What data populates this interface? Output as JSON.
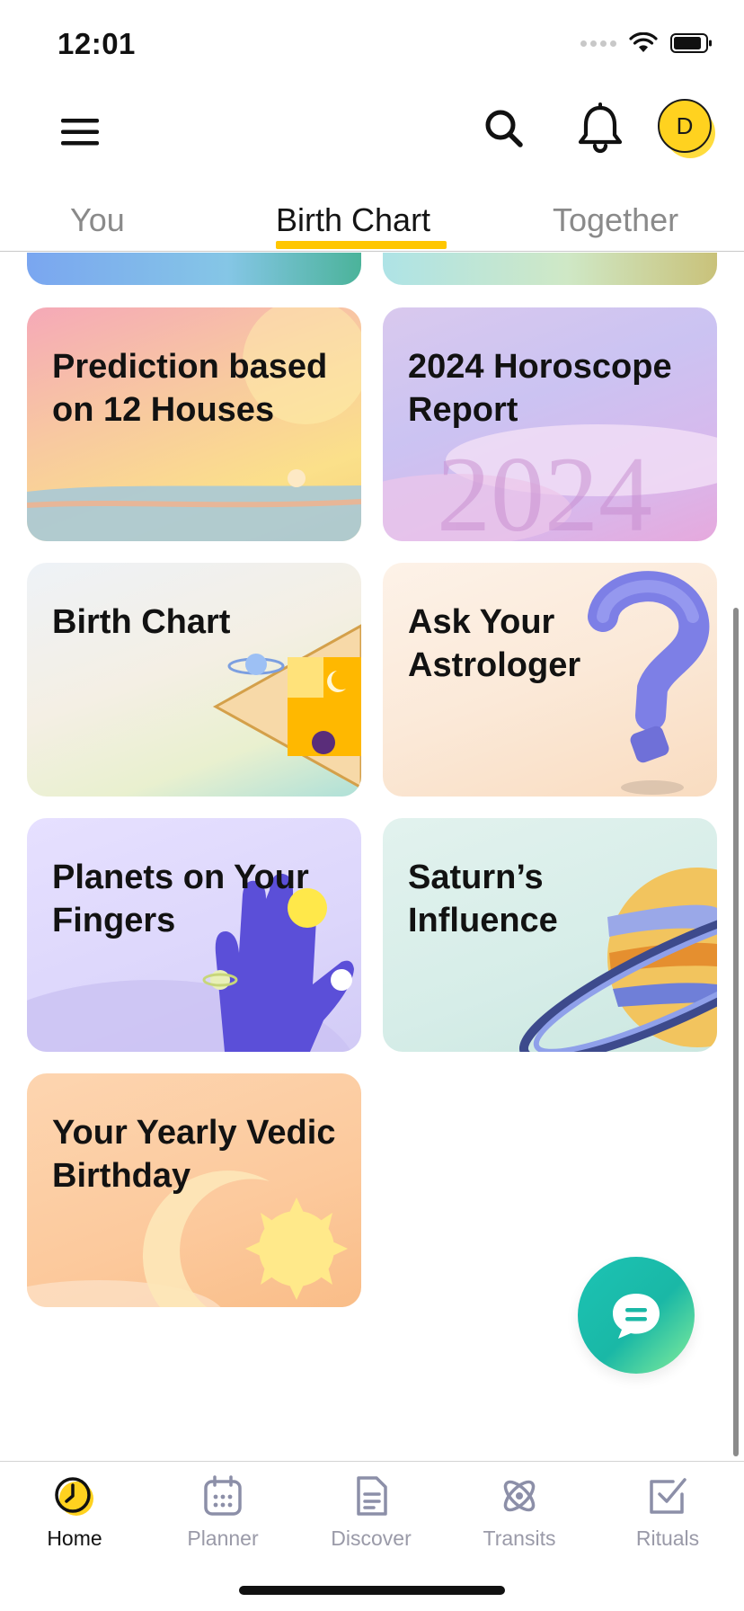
{
  "status_bar": {
    "time": "12:01"
  },
  "header": {
    "avatar_initial": "D"
  },
  "tabs": [
    {
      "label": "You",
      "active": false
    },
    {
      "label": "Birth Chart",
      "active": true
    },
    {
      "label": "Together",
      "active": false
    }
  ],
  "cards": [
    {
      "title": "Prediction based on 12 Houses"
    },
    {
      "title": "2024 Horoscope Report",
      "watermark": "2024"
    },
    {
      "title": "Birth Chart"
    },
    {
      "title": "Ask Your Astrologer"
    },
    {
      "title": "Planets on Your Fingers"
    },
    {
      "title": "Saturn’s Influence"
    },
    {
      "title": "Your Yearly Vedic Birthday"
    }
  ],
  "bottom_nav": [
    {
      "label": "Home",
      "icon": "home-clock-icon",
      "active": true
    },
    {
      "label": "Planner",
      "icon": "calendar-icon",
      "active": false
    },
    {
      "label": "Discover",
      "icon": "document-icon",
      "active": false
    },
    {
      "label": "Transits",
      "icon": "atom-icon",
      "active": false
    },
    {
      "label": "Rituals",
      "icon": "checkbox-icon",
      "active": false
    }
  ],
  "colors": {
    "accent": "#ffc700",
    "fab": "#1cc3b4",
    "nav_inactive": "#9a9aa8"
  }
}
